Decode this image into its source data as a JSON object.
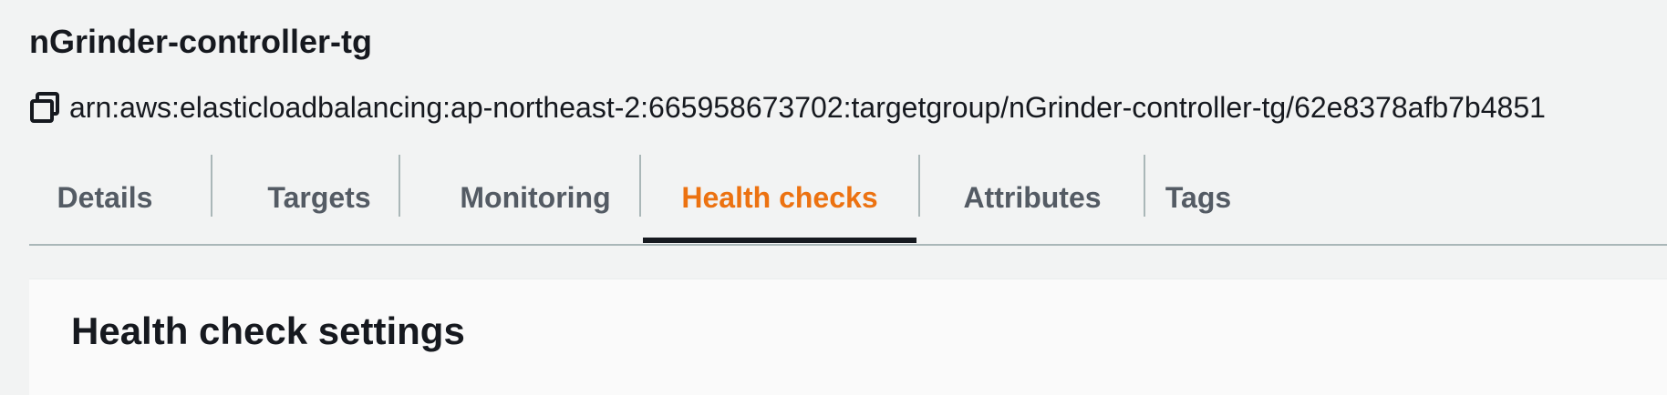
{
  "target_group": {
    "name": "nGrinder-controller-tg",
    "arn": "arn:aws:elasticloadbalancing:ap-northeast-2:665958673702:targetgroup/nGrinder-controller-tg/62e8378afb7b4851"
  },
  "tabs": [
    {
      "label": "Details"
    },
    {
      "label": "Targets"
    },
    {
      "label": "Monitoring"
    },
    {
      "label": "Health checks",
      "active": true
    },
    {
      "label": "Attributes"
    },
    {
      "label": "Tags"
    }
  ],
  "section": {
    "title": "Health check settings"
  },
  "colors": {
    "active_tab": "#ec7211",
    "inactive_tab": "#545b64",
    "text": "#16191f",
    "background": "#f2f3f3",
    "panel": "#fafafa"
  }
}
